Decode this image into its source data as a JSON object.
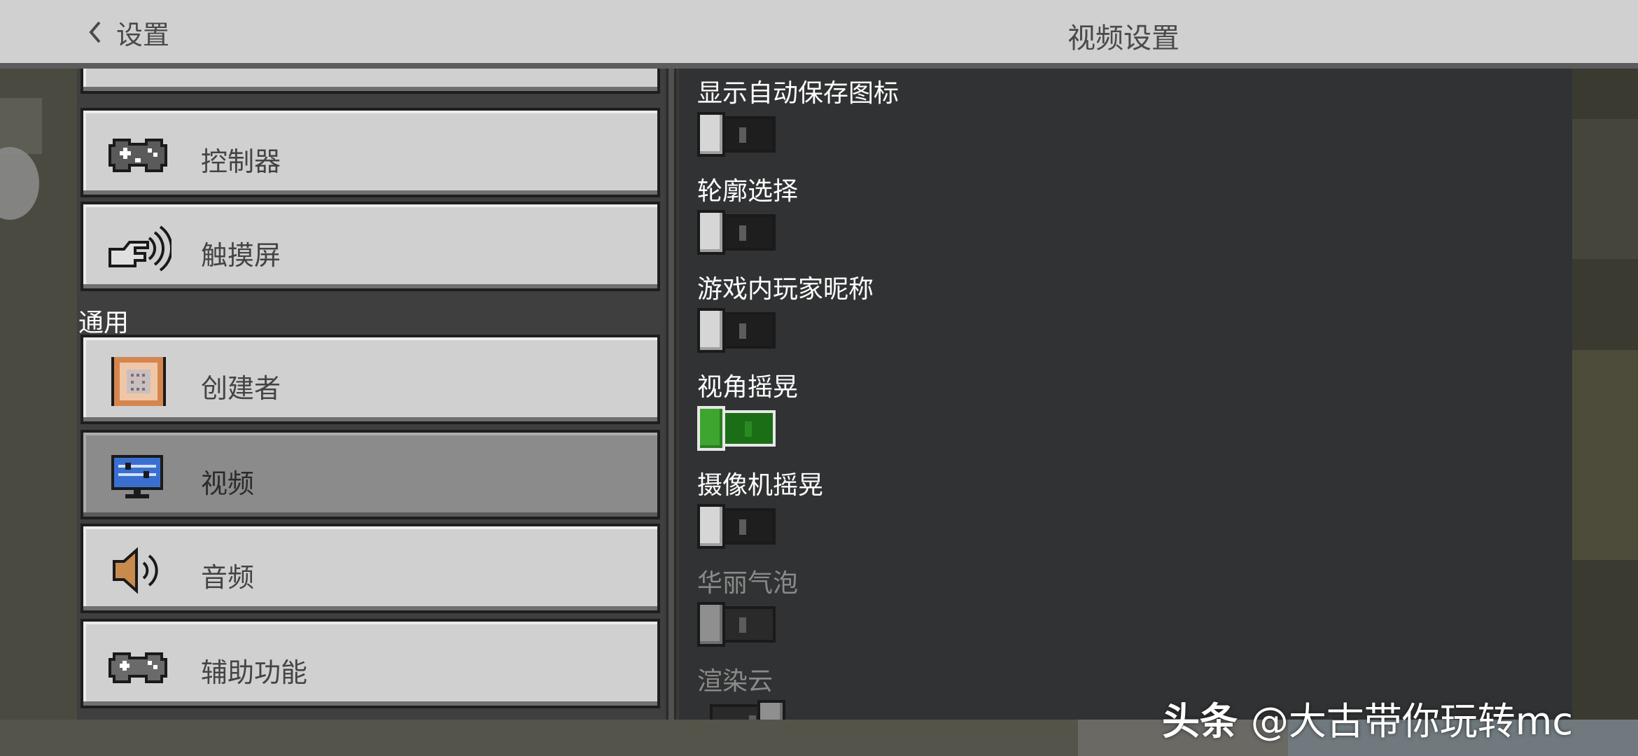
{
  "header": {
    "back_label": "设置",
    "title": "视频设置"
  },
  "sidebar": {
    "section_label": "通用",
    "items": [
      {
        "label": "",
        "icon": "unknown-icon"
      },
      {
        "label": "控制器",
        "icon": "gamepad-icon"
      },
      {
        "label": "触摸屏",
        "icon": "touch-hand-icon"
      },
      {
        "label": "创建者",
        "icon": "command-block-icon"
      },
      {
        "label": "视频",
        "icon": "monitor-icon",
        "selected": true
      },
      {
        "label": "音频",
        "icon": "speaker-icon"
      },
      {
        "label": "辅助功能",
        "icon": "gamepad-icon"
      }
    ]
  },
  "settings": [
    {
      "title": "显示自动保存图标",
      "state": "off"
    },
    {
      "title": "轮廓选择",
      "state": "off"
    },
    {
      "title": "游戏内玩家昵称",
      "state": "off"
    },
    {
      "title": "视角摇晃",
      "state": "on"
    },
    {
      "title": "摄像机摇晃",
      "state": "off"
    },
    {
      "title": "华丽气泡",
      "state": "off",
      "disabled": true
    },
    {
      "title": "渲染云",
      "state": "on",
      "disabled": true
    }
  ],
  "watermark": {
    "brand": "头条",
    "handle": "@大古带你玩转mc"
  },
  "colors": {
    "toggle_on": "#3ea52f",
    "panel": "#313233",
    "button": "#d0d0d0",
    "button_selected": "#8b8b8b"
  }
}
